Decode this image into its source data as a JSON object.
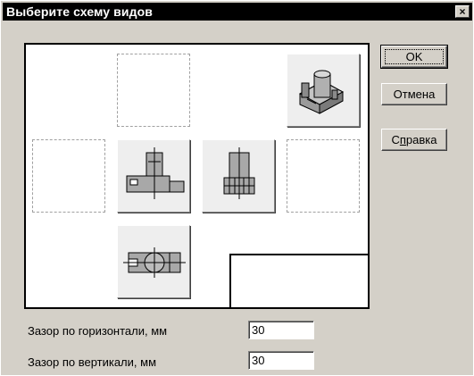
{
  "window": {
    "title": "Выберите схему видов",
    "close_glyph": "×"
  },
  "buttons": {
    "ok": "OK",
    "cancel": "Отмена",
    "help_prefix": "С",
    "help_underlined": "п",
    "help_suffix": "равка"
  },
  "fields": {
    "horizontal_gap_label": "Зазор по горизонтали, мм",
    "horizontal_gap_value": "30",
    "vertical_gap_label": "Зазор по вертикали, мм",
    "vertical_gap_value": "30"
  },
  "views": {
    "iso": "isometric-view-icon",
    "front": "front-view-icon",
    "side": "left-side-view-icon",
    "top": "top-view-icon"
  }
}
